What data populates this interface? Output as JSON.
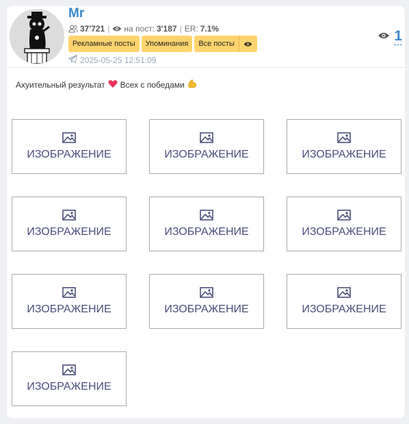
{
  "channel": {
    "name": "Mr",
    "subscribers": "37'721",
    "views_label": "на пост:",
    "views_per_post": "3'187",
    "er_label": "ER:",
    "er_value": "7.1%"
  },
  "buttons": {
    "ads": "Рекламные посты",
    "mentions": "Упоминания",
    "all_posts": "Все посты"
  },
  "post": {
    "date": "2025-05-25 12:51:09",
    "views": "1",
    "text": "Ахуительный результат",
    "text2": "Всех с победами"
  },
  "images": [
    {
      "label": "ИЗОБРАЖЕНИЕ"
    },
    {
      "label": "ИЗОБРАЖЕНИЕ"
    },
    {
      "label": "ИЗОБРАЖЕНИЕ"
    },
    {
      "label": "ИЗОБРАЖЕНИЕ"
    },
    {
      "label": "ИЗОБРАЖЕНИЕ"
    },
    {
      "label": "ИЗОБРАЖЕНИЕ"
    },
    {
      "label": "ИЗОБРАЖЕНИЕ"
    },
    {
      "label": "ИЗОБРАЖЕНИЕ"
    },
    {
      "label": "ИЗОБРАЖЕНИЕ"
    },
    {
      "label": "ИЗОБРАЖЕНИЕ"
    }
  ],
  "colors": {
    "accent": "#3a87c8",
    "button_bg": "#ffd36e",
    "tile_label": "#4a4e7a"
  }
}
